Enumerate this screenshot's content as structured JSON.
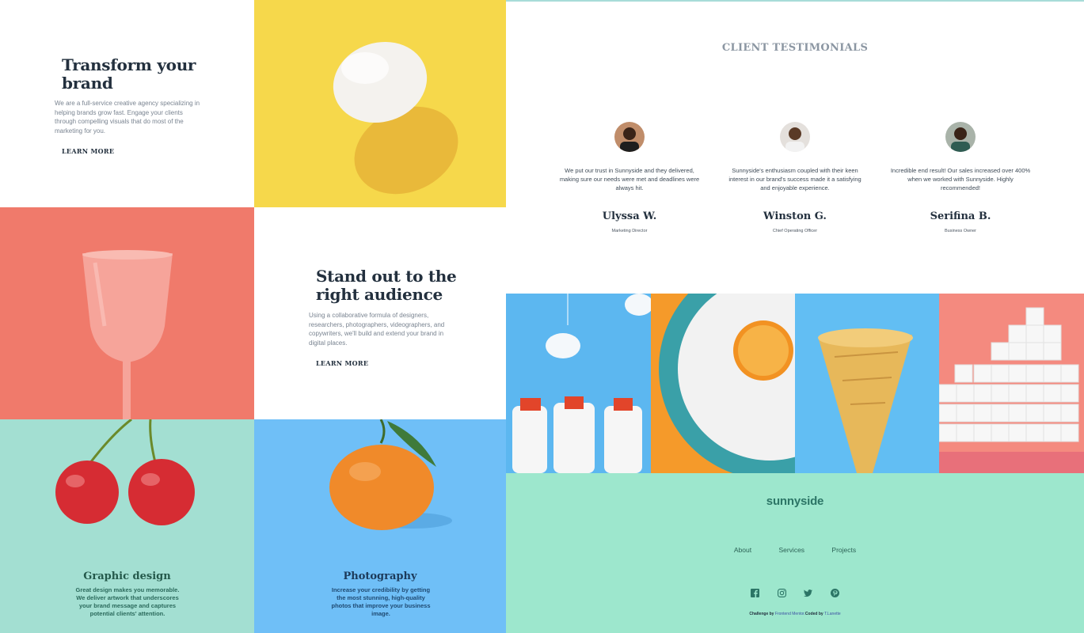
{
  "hero": {
    "title": "Transform your brand",
    "text": "We are a full-service creative agency specializing in helping brands grow fast. Engage your clients through compelling visuals that do most of the marketing for you.",
    "cta": "LEARN MORE"
  },
  "standout": {
    "title": "Stand out to the right audience",
    "text": "Using a collaborative formula of designers, researchers, photographers, videographers, and copywriters, we'll build and extend your brand in digital places.",
    "cta": "LEARN MORE"
  },
  "services": [
    {
      "title": "Graphic design",
      "text": "Great design makes you memorable. We deliver artwork that underscores your brand message and captures potential clients' attention."
    },
    {
      "title": "Photography",
      "text": "Increase your credibility by getting the most stunning, high-quality photos that improve your business image."
    }
  ],
  "testimonials": {
    "heading": "CLIENT TESTIMONIALS",
    "items": [
      {
        "quote": "We put our trust in Sunnyside and they delivered, making sure our needs were met and deadlines were always hit.",
        "name": "Ulyssa W.",
        "role": "Marketing Director"
      },
      {
        "quote": "Sunnyside's enthusiasm coupled with their keen interest in our brand's success made it a satisfying and enjoyable experience.",
        "name": "Winston G.",
        "role": "Chief Operating Officer"
      },
      {
        "quote": "Incredible end result! Our sales increased over 400% when we worked with Sunnyside. Highly recommended!",
        "name": "Serifina B.",
        "role": "Business Owner"
      }
    ]
  },
  "footer": {
    "logo": "sunnyside",
    "nav": [
      "About",
      "Services",
      "Projects"
    ],
    "social": [
      "facebook-icon",
      "instagram-icon",
      "twitter-icon",
      "pinterest-icon"
    ],
    "attribution": {
      "prefix": "Challenge by",
      "link1": "Frontend Mentor.",
      "middle": "Coded by",
      "link2": "T.Lanette"
    }
  },
  "colors": {
    "yellow": "#f6d84b",
    "coral": "#f07a6b",
    "mint": "#a3dfd2",
    "sky": "#6fbff7",
    "footer": "#9de7cd",
    "dark": "#23303e"
  }
}
